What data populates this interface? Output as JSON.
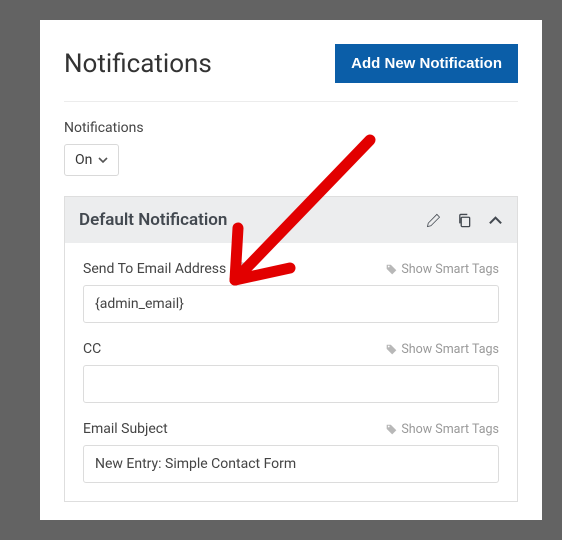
{
  "page_title": "Notifications",
  "add_button_label": "Add New Notification",
  "notifications_label": "Notifications",
  "notifications_toggle": {
    "value": "On"
  },
  "notification_panel": {
    "title": "Default Notification",
    "fields": {
      "send_to": {
        "label": "Send To Email Address",
        "value": "{admin_email}",
        "smart_tags_label": "Show Smart Tags",
        "has_help": true
      },
      "cc": {
        "label": "CC",
        "value": "",
        "smart_tags_label": "Show Smart Tags"
      },
      "email_subject": {
        "label": "Email Subject",
        "value": "New Entry: Simple Contact Form",
        "smart_tags_label": "Show Smart Tags"
      }
    }
  }
}
